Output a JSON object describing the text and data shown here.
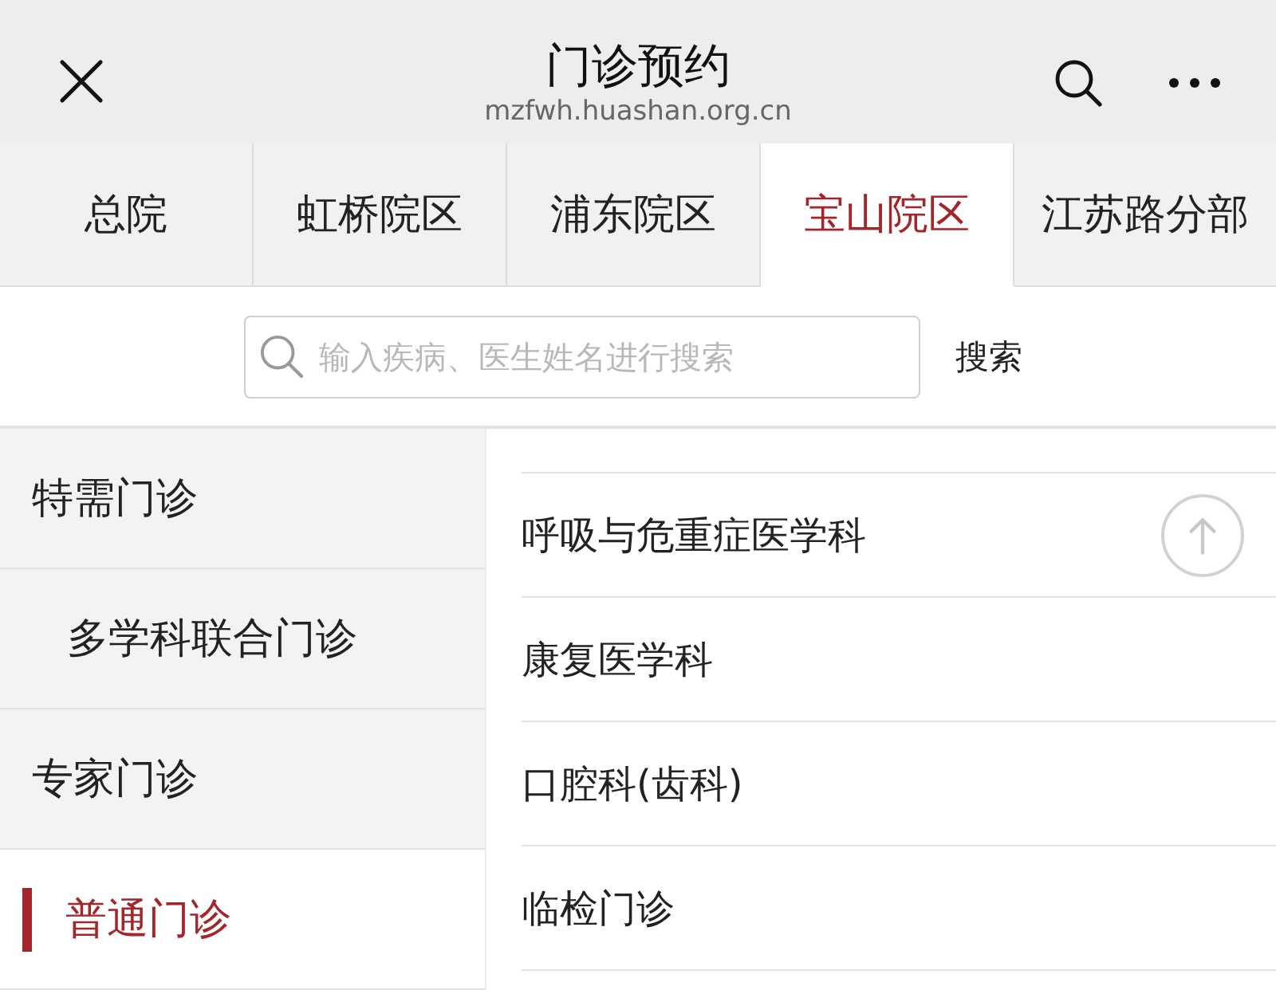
{
  "header": {
    "title": "门诊预约",
    "url": "mzfwh.huashan.org.cn"
  },
  "tabs": [
    {
      "label": "总院",
      "selected": false
    },
    {
      "label": "虹桥院区",
      "selected": false
    },
    {
      "label": "浦东院区",
      "selected": false
    },
    {
      "label": "宝山院区",
      "selected": true
    },
    {
      "label": "江苏路分部",
      "selected": false
    }
  ],
  "search": {
    "placeholder": "输入疾病、医生姓名进行搜索",
    "button": "搜索"
  },
  "sidebar": {
    "items": [
      {
        "label": "特需门诊",
        "selected": false,
        "children": [
          {
            "label": "多学科联合门诊",
            "selected": false
          }
        ]
      },
      {
        "label": "专家门诊",
        "selected": false
      },
      {
        "label": "普通门诊",
        "selected": true
      }
    ]
  },
  "departments": {
    "items": [
      "呼吸与危重症医学科",
      "康复医学科",
      "口腔科(齿科)",
      "临检门诊"
    ]
  }
}
